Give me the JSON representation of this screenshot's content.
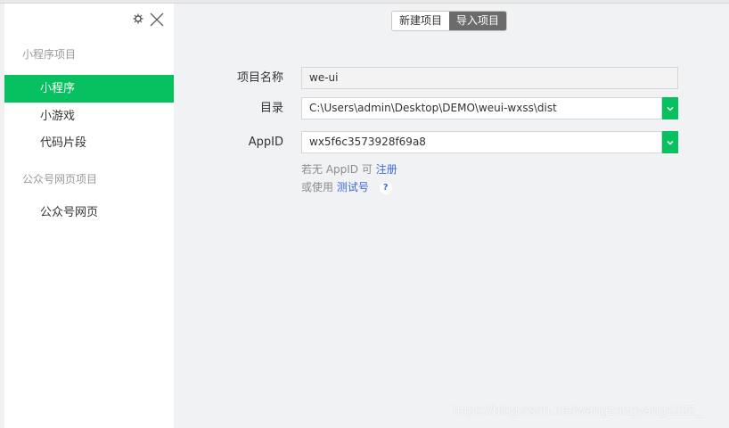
{
  "window": {
    "top_strip_visible": true
  },
  "sidebar": {
    "icons": {
      "settings": "gear-icon",
      "close": "close-icon"
    },
    "sections": [
      {
        "title": "小程序项目",
        "items": [
          {
            "label": "小程序",
            "active": true
          },
          {
            "label": "小游戏",
            "active": false
          },
          {
            "label": "代码片段",
            "active": false
          }
        ]
      },
      {
        "title": "公众号网页项目",
        "items": [
          {
            "label": "公众号网页",
            "active": false
          }
        ]
      }
    ]
  },
  "main": {
    "tabs": [
      {
        "label": "新建项目",
        "active": false
      },
      {
        "label": "导入项目",
        "active": true
      }
    ],
    "form": {
      "project_name": {
        "label": "项目名称",
        "value": "we-ui"
      },
      "directory": {
        "label": "目录",
        "value": "C:\\Users\\admin\\Desktop\\DEMO\\weui-wxss\\dist",
        "icon": "chevron-down-icon"
      },
      "appid": {
        "label": "AppID",
        "value": "wx5f6c3573928f69a8",
        "icon": "chevron-down-icon"
      }
    },
    "hints": {
      "no_appid_prefix": "若无 AppID 可",
      "register_link": "注册",
      "or_use_prefix": "或使用",
      "test_account_link": "测试号",
      "help_icon": "question-icon",
      "help_glyph": "?"
    }
  },
  "watermark": "https://blog.csdn.net/wangzongyang1025_",
  "colors": {
    "accent": "#07c160",
    "link": "#3f6ad8",
    "tab_active": "#6b6b6b",
    "main_bg": "#f1f2f4"
  }
}
